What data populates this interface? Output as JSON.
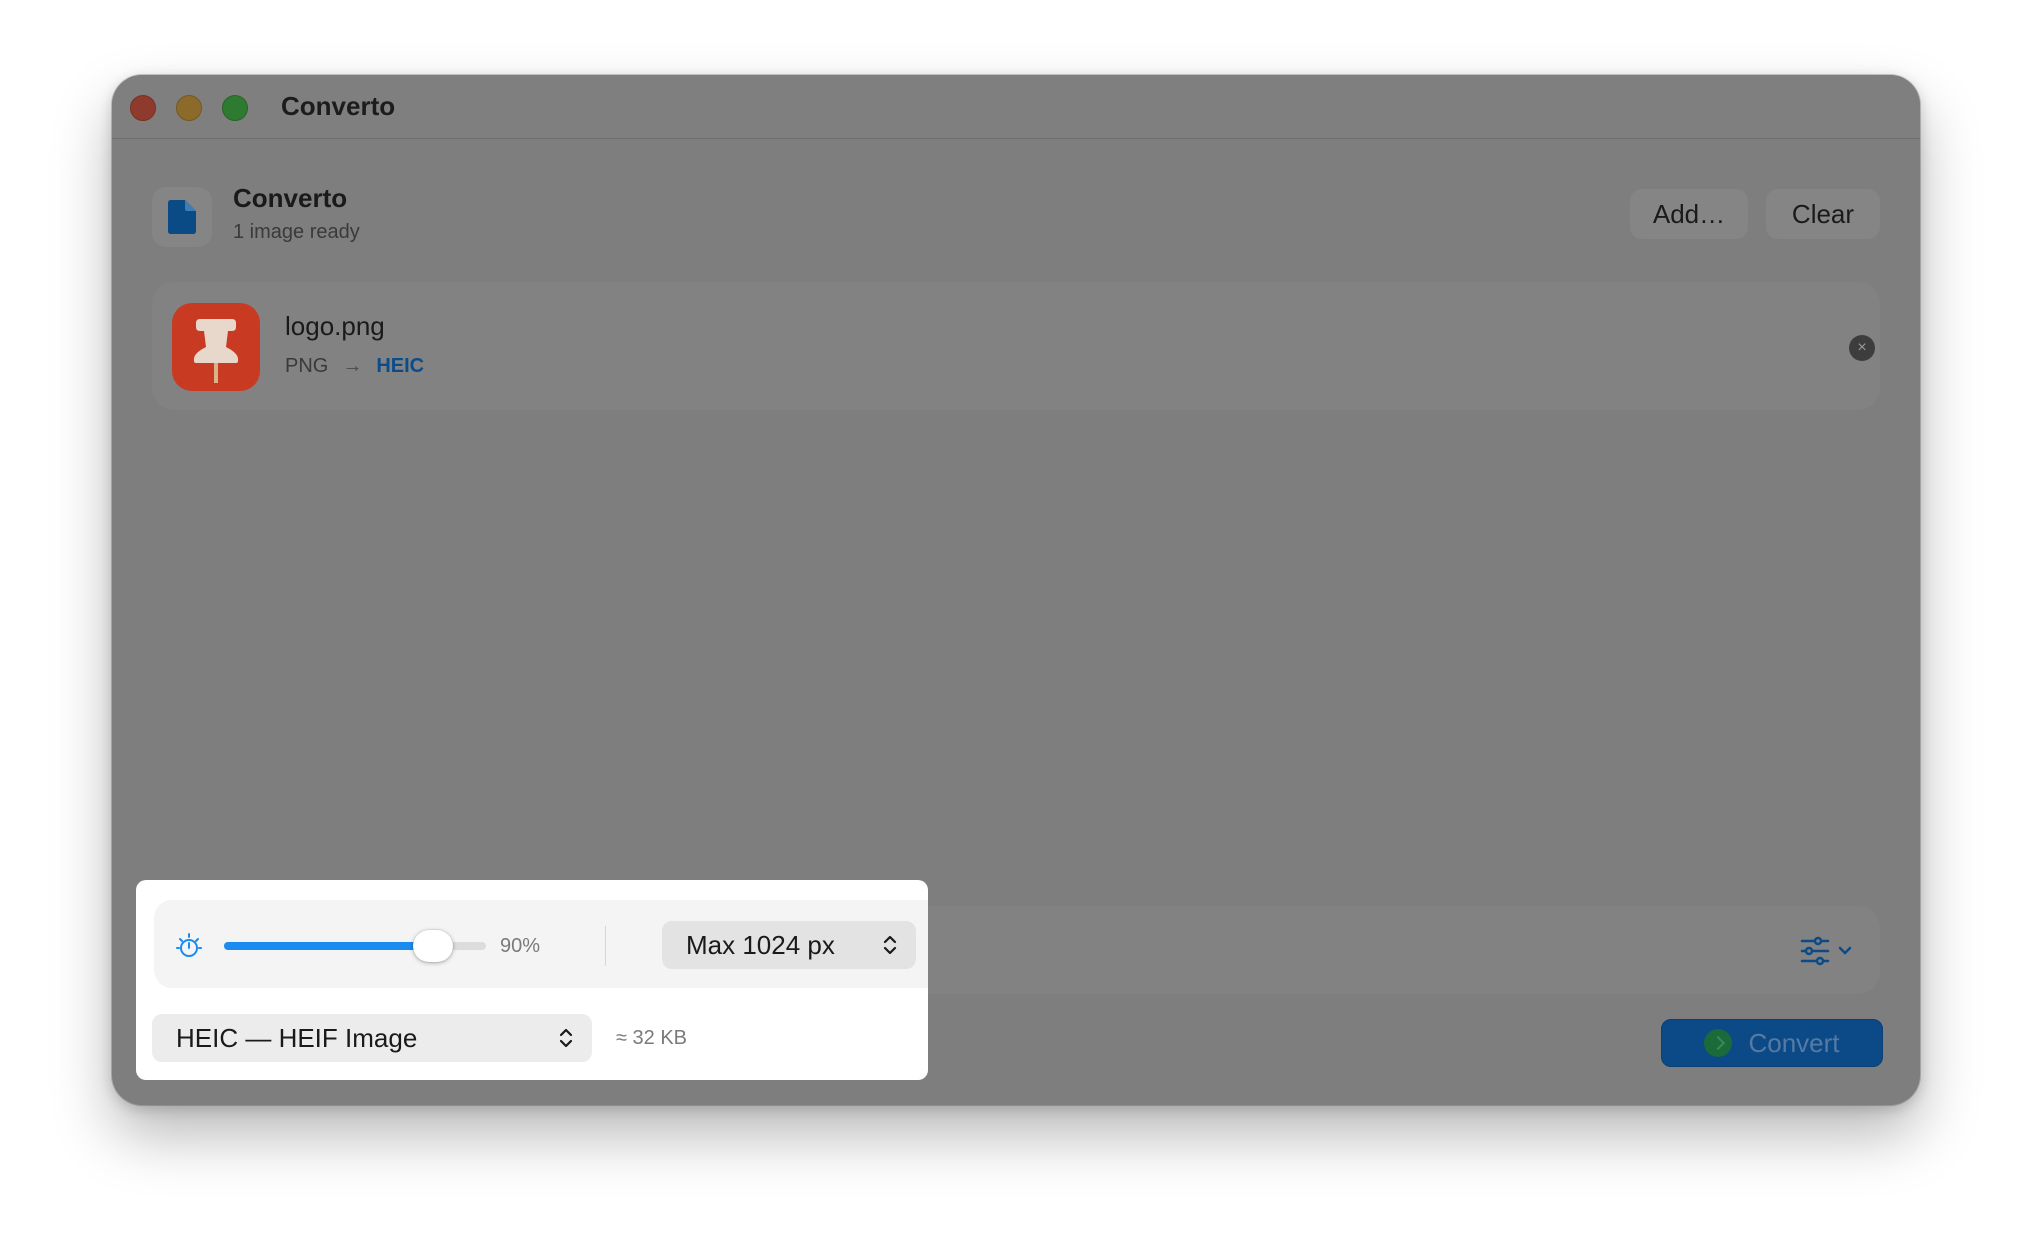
{
  "window": {
    "title": "Converto",
    "controls": [
      "close",
      "minimize",
      "maximize"
    ]
  },
  "header": {
    "app_name": "Converto",
    "status": "1 image ready",
    "icon": "document-icon",
    "add_label": "Add…",
    "clear_label": "Clear"
  },
  "files": [
    {
      "name": "logo.png",
      "from": "PNG",
      "arrow": "→",
      "to": "HEIC",
      "icon": "pushpin-app-icon",
      "remove_glyph": "×"
    }
  ],
  "settings": {
    "quality_icon": "quality-gauge-icon",
    "quality_percent": 90,
    "quality_label": "90%",
    "max_size_label": "Max 1024 px",
    "format_label": "HEIC — HEIF Image",
    "estimated_size": "≈ 32 KB",
    "options_icon": "sliders-icon"
  },
  "actions": {
    "convert_label": "Convert"
  },
  "colors": {
    "accent": "#1a8cf0",
    "format_highlight": "#0a4d8a",
    "file_icon_bg": "#c83a22"
  }
}
